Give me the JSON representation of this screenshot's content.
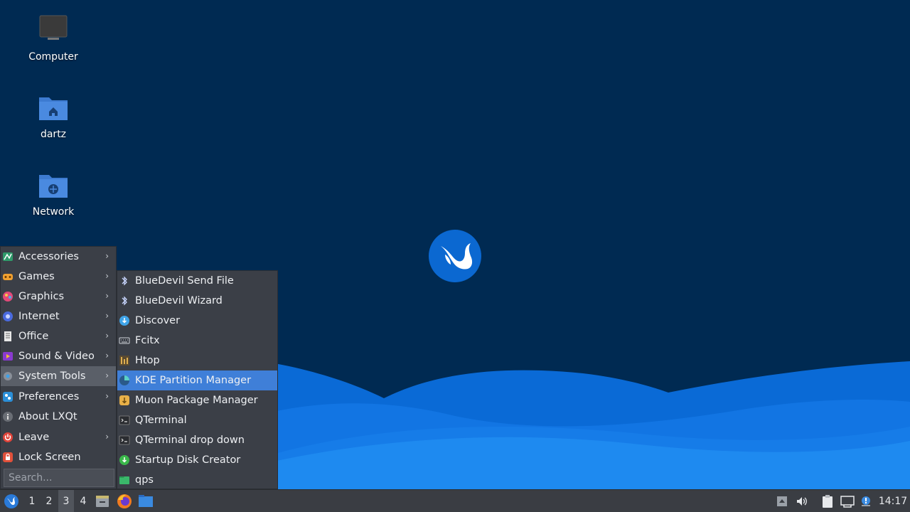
{
  "desktop": {
    "icons": [
      {
        "label": "Computer",
        "icon": "monitor-icon"
      },
      {
        "label": "dartz",
        "icon": "home-folder-icon"
      },
      {
        "label": "Network",
        "icon": "network-folder-icon"
      }
    ]
  },
  "main_menu": {
    "items": [
      {
        "label": "Accessories",
        "icon": "accessories-icon",
        "has_submenu": true
      },
      {
        "label": "Games",
        "icon": "games-icon",
        "has_submenu": true
      },
      {
        "label": "Graphics",
        "icon": "graphics-icon",
        "has_submenu": true
      },
      {
        "label": "Internet",
        "icon": "internet-icon",
        "has_submenu": true
      },
      {
        "label": "Office",
        "icon": "office-icon",
        "has_submenu": true
      },
      {
        "label": "Sound & Video",
        "icon": "sound-video-icon",
        "has_submenu": true
      },
      {
        "label": "System Tools",
        "icon": "system-tools-icon",
        "has_submenu": true,
        "active": true
      },
      {
        "label": "Preferences",
        "icon": "preferences-icon",
        "has_submenu": true
      },
      {
        "label": "About LXQt",
        "icon": "info-icon",
        "has_submenu": false
      },
      {
        "label": "Leave",
        "icon": "power-icon",
        "has_submenu": true
      },
      {
        "label": "Lock Screen",
        "icon": "lock-icon",
        "has_submenu": false
      }
    ],
    "arrow_glyph": "›",
    "search_placeholder": "Search..."
  },
  "submenu": {
    "items": [
      {
        "label": "BlueDevil Send File",
        "icon": "bluetooth-icon"
      },
      {
        "label": "BlueDevil Wizard",
        "icon": "bluetooth-icon"
      },
      {
        "label": "Discover",
        "icon": "discover-icon"
      },
      {
        "label": "Fcitx",
        "icon": "keyboard-icon"
      },
      {
        "label": "Htop",
        "icon": "htop-icon"
      },
      {
        "label": "KDE Partition Manager",
        "icon": "partition-manager-icon",
        "highlighted": true
      },
      {
        "label": "Muon Package Manager",
        "icon": "package-manager-icon"
      },
      {
        "label": "QTerminal",
        "icon": "terminal-icon"
      },
      {
        "label": "QTerminal drop down",
        "icon": "terminal-icon"
      },
      {
        "label": "Startup Disk Creator",
        "icon": "disk-creator-icon"
      },
      {
        "label": "qps",
        "icon": "qps-icon"
      }
    ]
  },
  "taskbar": {
    "workspaces": [
      "1",
      "2",
      "3",
      "4"
    ],
    "active_workspace": "3",
    "clock": "14:17"
  },
  "colors": {
    "desktop_bg": "#002a52",
    "wave_light": "#1e8af0",
    "wave_dark": "#0a6ad6",
    "menu_bg": "#3b3f47",
    "highlight": "#3f7fd8",
    "taskbar_bg": "#3a3d43"
  }
}
